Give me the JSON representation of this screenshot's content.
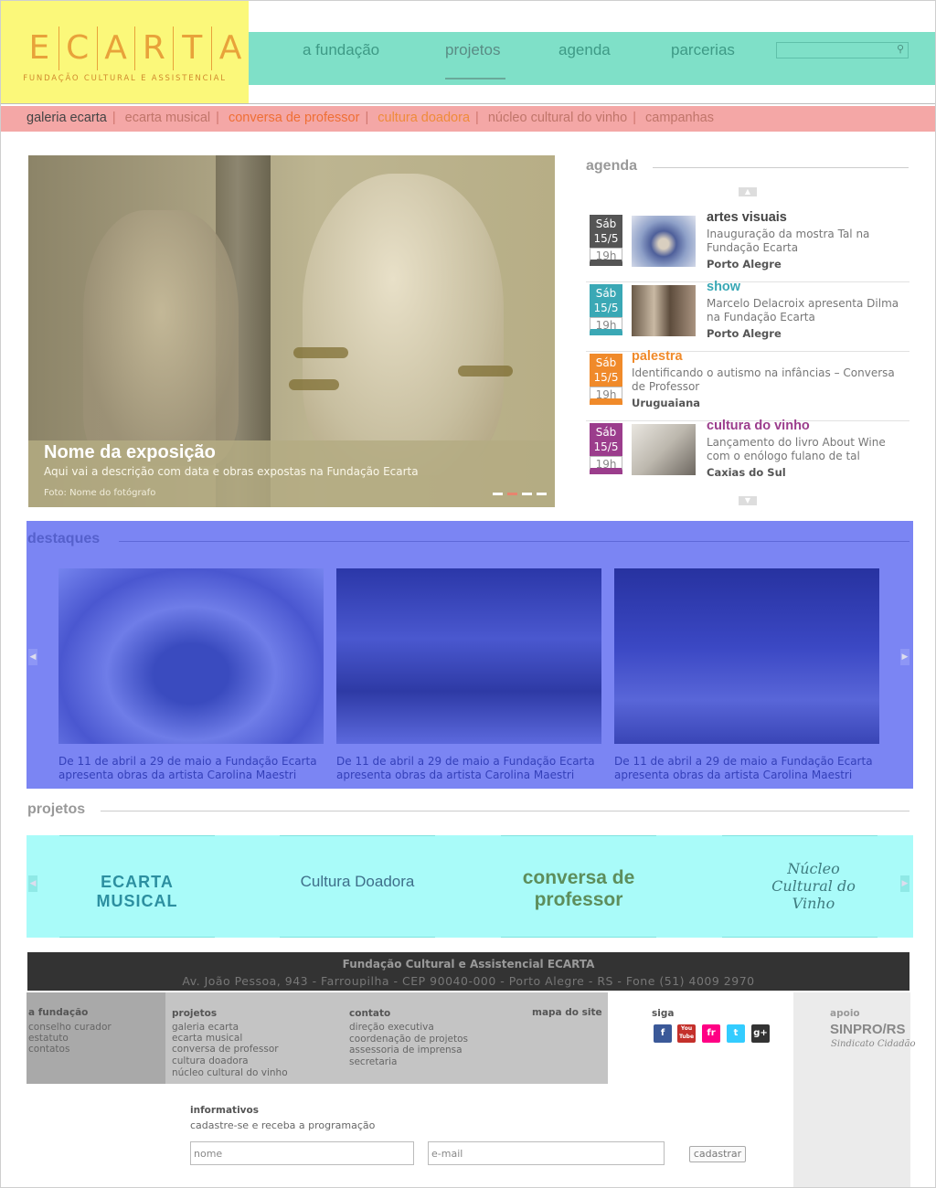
{
  "header": {
    "logo_letters": [
      "E",
      "C",
      "A",
      "R",
      "T",
      "A"
    ],
    "logo_subtitle": "FUNDAÇÃO CULTURAL E ASSISTENCIAL",
    "nav": [
      "a fundação",
      "projetos",
      "agenda",
      "parcerias"
    ],
    "active_nav": "projetos",
    "search_placeholder": ""
  },
  "subnav": [
    "galeria ecarta",
    "ecarta musical",
    "conversa de professor",
    "cultura doadora",
    "núcleo cultural do vinho",
    "campanhas"
  ],
  "hero": {
    "title": "Nome da exposição",
    "description": "Aqui vai a descrição com data e obras expostas na Fundação Ecarta",
    "photo_credit": "Foto: Nome do fotógrafo",
    "slides": 4,
    "active_slide": 2
  },
  "agenda": {
    "title": "agenda",
    "events": [
      {
        "day": "Sáb",
        "date": "15/5",
        "time": "19h",
        "category": "artes visuais",
        "desc": "Inauguração da mostra Tal na Fundação Ecarta",
        "location": "Porto Alegre",
        "color": "#555555",
        "thumb": true
      },
      {
        "day": "Sáb",
        "date": "15/5",
        "time": "19h",
        "category": "show",
        "desc": "Marcelo Delacroix apresenta Dilma na Fundação Ecarta",
        "location": "Porto Alegre",
        "color": "#3aa8b5",
        "thumb": true
      },
      {
        "day": "Sáb",
        "date": "15/5",
        "time": "19h",
        "category": "palestra",
        "desc": "Identificando o autismo na infâncias – Conversa de Professor",
        "location": "Uruguaiana",
        "color": "#f08a2a",
        "thumb": false
      },
      {
        "day": "Sáb",
        "date": "15/5",
        "time": "19h",
        "category": "cultura do vinho",
        "desc": "Lançamento do livro About Wine com o enólogo fulano de tal",
        "location": "Caxias do Sul",
        "color": "#9b3d8c",
        "thumb": true
      }
    ]
  },
  "destaques": {
    "title": "destaques",
    "items": [
      {
        "text": "De 11 de abril a 29 de maio a Fundação Ecarta apresenta obras da artista Carolina Maestri"
      },
      {
        "text": "De 11 de abril a 29 de maio a Fundação Ecarta apresenta obras da artista Carolina Maestri"
      },
      {
        "text": "De 11 de abril a 29 de maio a Fundação Ecarta apresenta obras da artista Carolina Maestri"
      }
    ]
  },
  "projetos": {
    "title": "projetos",
    "logos": [
      "ECARTA MUSICAL",
      "Cultura Doadora",
      "conversa de professor",
      "Núcleo Cultural do Vinho"
    ]
  },
  "footer": {
    "org": "Fundação Cultural e Assistencial ECARTA",
    "address": "Av. João Pessoa, 943 - Farroupilha - CEP 90040-000 - Porto Alegre - RS - Fone (51) 4009 2970",
    "col1": {
      "title": "a fundação",
      "links": [
        "conselho curador",
        "estatuto",
        "contatos"
      ]
    },
    "col2": {
      "title": "projetos",
      "links": [
        "galeria ecarta",
        "ecarta musical",
        "conversa de professor",
        "cultura doadora",
        "núcleo cultural do vinho"
      ]
    },
    "col3": {
      "title": "contato",
      "links": [
        "direção executiva",
        "coordenação de projetos",
        "assessoria de imprensa",
        "secretaria"
      ]
    },
    "col3b": {
      "title": "mapa do site"
    },
    "siga": "siga",
    "social": [
      "f",
      "You Tube",
      "fr",
      "t",
      "g+"
    ],
    "apoio": "apoio",
    "apoio_logo": "SINPRO/RS",
    "apoio_sub": "Sindicato Cidadão",
    "newsletter": {
      "title": "informativos",
      "subtitle": "cadastre-se e receba a programação",
      "name_placeholder": "nome",
      "email_placeholder": "e-mail",
      "button": "cadastrar"
    }
  }
}
